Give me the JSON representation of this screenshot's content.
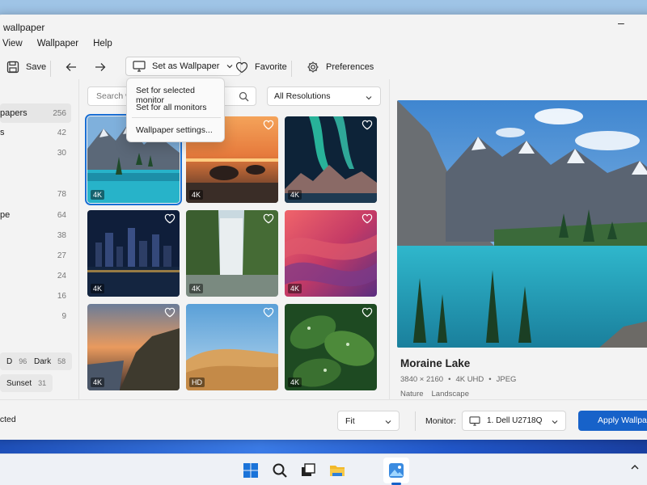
{
  "window": {
    "title": "d wallpaper",
    "minimize_glyph": "–"
  },
  "menu": [
    "View",
    "Wallpaper",
    "Help"
  ],
  "toolbar": {
    "save_label": "Save",
    "set_wallpaper_label": "Set as Wallpaper",
    "favorite_label": "Favorite",
    "preferences_label": "Preferences"
  },
  "dropdown": {
    "items": [
      "Set for selected monitor",
      "Set for all monitors",
      "Wallpaper settings..."
    ]
  },
  "sidebar": {
    "items": [
      {
        "label": "papers",
        "count": "256"
      },
      {
        "label": "s",
        "count": "42"
      },
      {
        "label": "",
        "count": "30"
      },
      {
        "label": "",
        "count": "78"
      },
      {
        "label": "pe",
        "count": "64"
      },
      {
        "label": "",
        "count": "38"
      },
      {
        "label": "",
        "count": "27"
      },
      {
        "label": "",
        "count": "24"
      },
      {
        "label": "",
        "count": "16"
      },
      {
        "label": "",
        "count": "9"
      }
    ],
    "tags": [
      {
        "label": "D",
        "count": "96"
      },
      {
        "label": "Dark",
        "count": "58"
      },
      {
        "label": "Sunset",
        "count": "31"
      }
    ]
  },
  "search": {
    "placeholder": "Search wa"
  },
  "resolution_filter": {
    "value": "All Resolutions"
  },
  "thumbnails": [
    {
      "badge": "4K",
      "name": "lake"
    },
    {
      "badge": "4K",
      "name": "sunset-rocks"
    },
    {
      "badge": "4K",
      "name": "aurora"
    },
    {
      "badge": "4K",
      "name": "city-night"
    },
    {
      "badge": "4K",
      "name": "waterfall"
    },
    {
      "badge": "4K",
      "name": "abstract-waves"
    },
    {
      "badge": "4K",
      "name": "coast-sunset"
    },
    {
      "badge": "HD",
      "name": "desert-dunes"
    },
    {
      "badge": "4K",
      "name": "wet-leaves"
    }
  ],
  "preview": {
    "title": "Moraine Lake",
    "resolution": "3840 × 2160",
    "quality": "4K UHD",
    "format": "JPEG",
    "dot": "•",
    "tags": [
      "Nature",
      "Landscape"
    ]
  },
  "footer": {
    "status": "ected",
    "fit_value": "Fit",
    "monitor_label": "Monitor:",
    "monitor_value": "1. Dell U2718Q",
    "apply_label": "Apply Wallpaper"
  },
  "colors": {
    "accent": "#1762c9",
    "window_bg": "#f3f3f3"
  }
}
